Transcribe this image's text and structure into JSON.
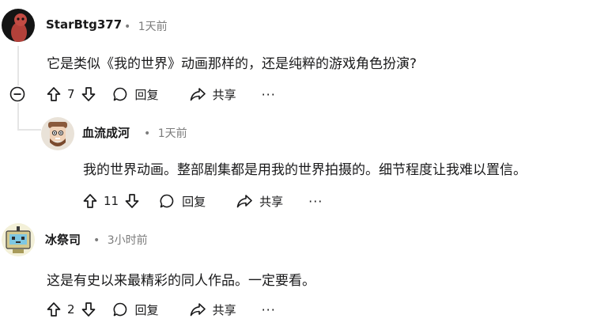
{
  "comments": [
    {
      "username": "StarBtg377",
      "time": "1天前",
      "body": "它是类似《我的世界》动画那样的，还是纯粹的游戏角色扮演?",
      "votes": "7",
      "reply_label": "回复",
      "share_label": "共享",
      "more_label": "···"
    },
    {
      "username": "血流成河",
      "time": "1天前",
      "body": "我的世界动画。整部剧集都是用我的世界拍摄的。细节程度让我难以置信。",
      "votes": "11",
      "reply_label": "回复",
      "share_label": "共享",
      "more_label": "···"
    },
    {
      "username": "冰祭司",
      "time": "3小时前",
      "body": "这是有史以来最精彩的同人作品。一定要看。",
      "votes": "2",
      "reply_label": "回复",
      "share_label": "共享",
      "more_label": "···"
    }
  ],
  "separator": "•",
  "colors": {
    "accent": "#1a1a1b",
    "meta": "#7c7c7c",
    "thread_line": "#e5e5e5"
  }
}
